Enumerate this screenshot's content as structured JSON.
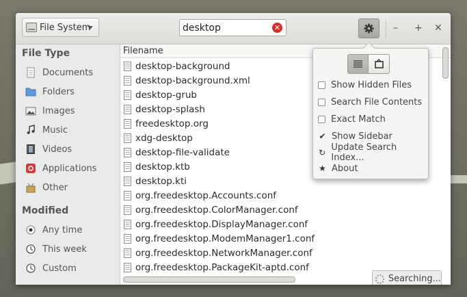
{
  "toolbar": {
    "filesystem_label": "File System",
    "search_value": "desktop"
  },
  "sidebar": {
    "file_type_heading": "File Type",
    "file_types": [
      {
        "label": "Documents",
        "icon": "document-icon"
      },
      {
        "label": "Folders",
        "icon": "folder-icon"
      },
      {
        "label": "Images",
        "icon": "image-icon"
      },
      {
        "label": "Music",
        "icon": "music-icon"
      },
      {
        "label": "Videos",
        "icon": "video-icon"
      },
      {
        "label": "Applications",
        "icon": "applications-icon"
      },
      {
        "label": "Other",
        "icon": "other-icon"
      }
    ],
    "modified_heading": "Modified",
    "modified": [
      {
        "label": "Any time",
        "icon": "radio-selected-icon"
      },
      {
        "label": "This week",
        "icon": "clock-icon"
      },
      {
        "label": "Custom",
        "icon": "clock-icon"
      }
    ]
  },
  "results": {
    "column_header": "Filename",
    "files": [
      "desktop-background",
      "desktop-background.xml",
      "desktop-grub",
      "desktop-splash",
      "freedesktop.org",
      "xdg-desktop",
      "desktop-file-validate",
      "desktop.ktb",
      "desktop.kti",
      "org.freedesktop.Accounts.conf",
      "org.freedesktop.ColorManager.conf",
      "org.freedesktop.DisplayManager.conf",
      "org.freedesktop.ModemManager1.conf",
      "org.freedesktop.NetworkManager.conf",
      "org.freedesktop.PackageKit-aptd.conf"
    ],
    "status": "Searching..."
  },
  "menu": {
    "items": [
      {
        "label": "Show Hidden Files",
        "checked": false
      },
      {
        "label": "Search File Contents",
        "checked": false
      },
      {
        "label": "Exact Match",
        "checked": false
      },
      {
        "label": "Show Sidebar",
        "checked": true
      },
      {
        "label": "Update Search Index...",
        "icon": "refresh-icon"
      },
      {
        "label": "About",
        "icon": "star-icon"
      }
    ]
  }
}
